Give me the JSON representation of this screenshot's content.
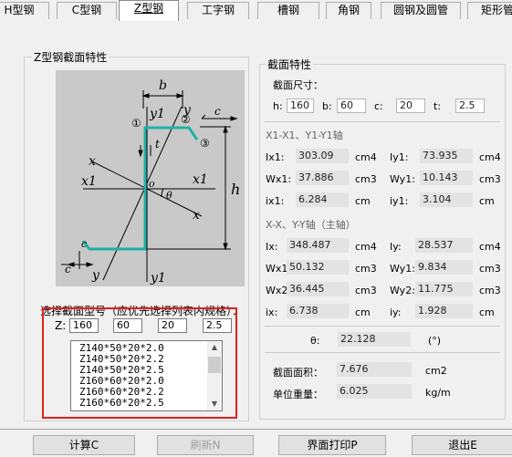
{
  "tabs": [
    {
      "label": "H型钢",
      "active": false
    },
    {
      "label": "C型钢",
      "active": false
    },
    {
      "label": "Z型钢",
      "active": true
    },
    {
      "label": "工字钢",
      "active": false
    },
    {
      "label": "槽钢",
      "active": false
    },
    {
      "label": "角钢",
      "active": false
    },
    {
      "label": "圆钢及圆管",
      "active": false
    },
    {
      "label": "矩形管",
      "active": false
    }
  ],
  "left_group": {
    "title": "Z型钢截面特性",
    "diagram_labels": {
      "b": "b",
      "c": "c",
      "h": "h",
      "t": "t",
      "theta": "θ",
      "o": "o",
      "x": "x",
      "y": "y",
      "x1": "x1",
      "y1": "y1",
      "c1": "①",
      "c2": "②",
      "c3": "③"
    },
    "select_prompt": "选择截面型号（应优先选择列表内规格）：",
    "z_label": "Z:",
    "inputs": [
      "160",
      "60",
      "20",
      "2.5"
    ],
    "list_items": [
      "Z140*50*20*2.0",
      "Z140*50*20*2.2",
      "Z140*50*20*2.5",
      "Z160*60*20*2.0",
      "Z160*60*20*2.2",
      "Z160*60*20*2.5"
    ]
  },
  "right_group": {
    "title": "截面特性",
    "dims_label": "截面尺寸：",
    "dims": [
      {
        "label": "h:",
        "value": "160"
      },
      {
        "label": "b:",
        "value": "60"
      },
      {
        "label": "c:",
        "value": "20"
      },
      {
        "label": "t:",
        "value": "2.5"
      }
    ],
    "axis1_title": "X1-X1、Y1-Y1轴",
    "axis1_rows": [
      {
        "l1": "Ix1:",
        "v1": "303.09",
        "u1": "cm4",
        "l2": "Iy1:",
        "v2": "73.935",
        "u2": "cm4"
      },
      {
        "l1": "Wx1:",
        "v1": "37.886",
        "u1": "cm3",
        "l2": "Wy1:",
        "v2": "10.143",
        "u2": "cm3"
      },
      {
        "l1": "ix1:",
        "v1": "6.284",
        "u1": "cm",
        "l2": "iy1:",
        "v2": "3.104",
        "u2": "cm"
      }
    ],
    "axis2_title": "X-X、Y-Y轴（主轴）",
    "axis2_rows": [
      {
        "l1": "Ix:",
        "v1": "348.487",
        "u1": "cm4",
        "l2": "Iy:",
        "v2": "28.537",
        "u2": "cm4"
      },
      {
        "l1": "Wx1:",
        "v1": "50.132",
        "u1": "cm3",
        "l2": "Wy1:",
        "v2": "9.834",
        "u2": "cm3"
      },
      {
        "l1": "Wx2:",
        "v1": "36.445",
        "u1": "cm3",
        "l2": "Wy2:",
        "v2": "11.775",
        "u2": "cm3"
      },
      {
        "l1": "ix:",
        "v1": "6.738",
        "u1": "cm",
        "l2": "iy:",
        "v2": "1.928",
        "u2": "cm"
      }
    ],
    "theta": {
      "label": "θ:",
      "value": "22.128",
      "unit": "(°)"
    },
    "area": {
      "label": "截面面积：",
      "value": "7.676",
      "unit": "cm2"
    },
    "weight": {
      "label": "单位重量：",
      "value": "6.025",
      "unit": "kg/m"
    }
  },
  "buttons": {
    "calc": "计算C",
    "refresh": "刷新N",
    "print": "界面打印P",
    "exit": "退出E"
  }
}
